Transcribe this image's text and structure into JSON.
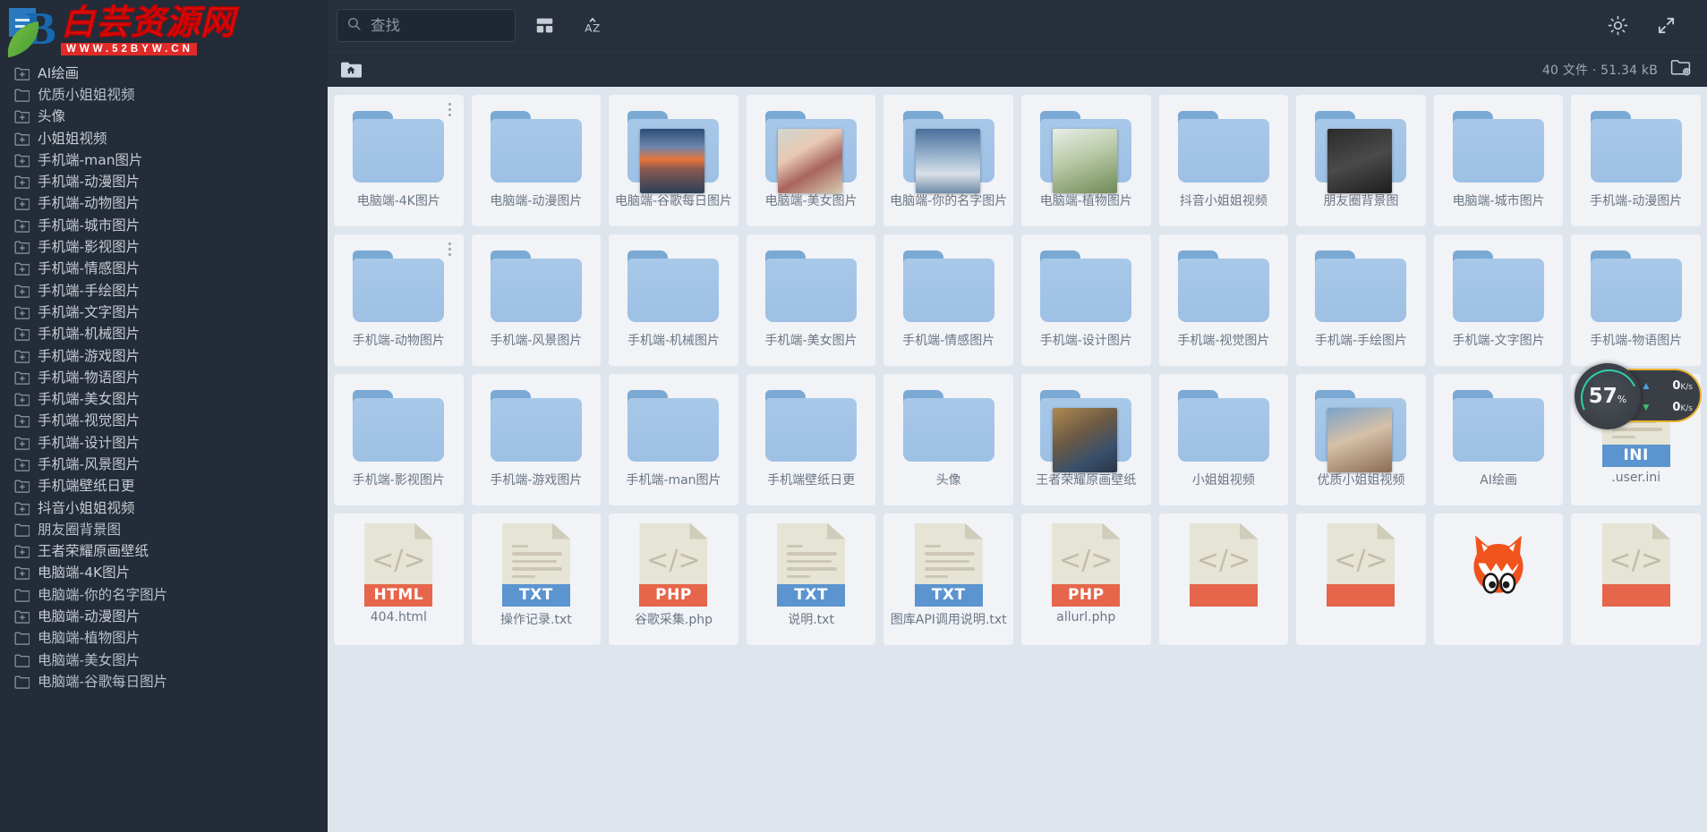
{
  "brand": {
    "title": "白芸资源网",
    "url": "WWW.52BYW.CN",
    "logo_icon": "leaf-b-logo-icon"
  },
  "sidebar": {
    "items": [
      {
        "label": "AI绘画",
        "icon": "folder-plus-icon",
        "expandable": true
      },
      {
        "label": "优质小姐姐视频",
        "icon": "folder-icon",
        "expandable": false
      },
      {
        "label": "头像",
        "icon": "folder-plus-icon",
        "expandable": true
      },
      {
        "label": "小姐姐视频",
        "icon": "folder-plus-icon",
        "expandable": true
      },
      {
        "label": "手机端-man图片",
        "icon": "folder-plus-icon",
        "expandable": true
      },
      {
        "label": "手机端-动漫图片",
        "icon": "folder-plus-icon",
        "expandable": true
      },
      {
        "label": "手机端-动物图片",
        "icon": "folder-plus-icon",
        "expandable": true
      },
      {
        "label": "手机端-城市图片",
        "icon": "folder-plus-icon",
        "expandable": true
      },
      {
        "label": "手机端-影视图片",
        "icon": "folder-plus-icon",
        "expandable": true
      },
      {
        "label": "手机端-情感图片",
        "icon": "folder-plus-icon",
        "expandable": true
      },
      {
        "label": "手机端-手绘图片",
        "icon": "folder-plus-icon",
        "expandable": true
      },
      {
        "label": "手机端-文字图片",
        "icon": "folder-plus-icon",
        "expandable": true
      },
      {
        "label": "手机端-机械图片",
        "icon": "folder-plus-icon",
        "expandable": true
      },
      {
        "label": "手机端-游戏图片",
        "icon": "folder-plus-icon",
        "expandable": true
      },
      {
        "label": "手机端-物语图片",
        "icon": "folder-plus-icon",
        "expandable": true
      },
      {
        "label": "手机端-美女图片",
        "icon": "folder-plus-icon",
        "expandable": true
      },
      {
        "label": "手机端-视觉图片",
        "icon": "folder-plus-icon",
        "expandable": true
      },
      {
        "label": "手机端-设计图片",
        "icon": "folder-plus-icon",
        "expandable": true
      },
      {
        "label": "手机端-风景图片",
        "icon": "folder-plus-icon",
        "expandable": true
      },
      {
        "label": "手机端壁纸日更",
        "icon": "folder-plus-icon",
        "expandable": true
      },
      {
        "label": "抖音小姐姐视频",
        "icon": "folder-plus-icon",
        "expandable": true
      },
      {
        "label": "朋友圈背景图",
        "icon": "folder-icon",
        "expandable": false
      },
      {
        "label": "王者荣耀原画壁纸",
        "icon": "folder-plus-icon",
        "expandable": true
      },
      {
        "label": "电脑端-4K图片",
        "icon": "folder-plus-icon",
        "expandable": true
      },
      {
        "label": "电脑端-你的名字图片",
        "icon": "folder-icon",
        "expandable": false
      },
      {
        "label": "电脑端-动漫图片",
        "icon": "folder-plus-icon",
        "expandable": true
      },
      {
        "label": "电脑端-植物图片",
        "icon": "folder-icon",
        "expandable": false
      },
      {
        "label": "电脑端-美女图片",
        "icon": "folder-icon",
        "expandable": false
      },
      {
        "label": "电脑端-谷歌每日图片",
        "icon": "folder-icon",
        "expandable": false
      }
    ]
  },
  "toolbar": {
    "search_placeholder": "查找",
    "search_value": "",
    "search_icon": "search-icon",
    "view_icon": "grid-view-icon",
    "sort_icon": "sort-az-icon",
    "theme_icon": "sun-brightness-icon",
    "fullscreen_icon": "fullscreen-expand-icon"
  },
  "pathbar": {
    "home_icon": "home-folder-icon",
    "count_text": "40 文件 · 51.34 kB",
    "settings_icon": "folder-settings-icon"
  },
  "files": [
    {
      "name": "电脑端-4K图片",
      "kind": "folder",
      "thumb": null,
      "badge": null,
      "menu": true
    },
    {
      "name": "电脑端-动漫图片",
      "kind": "folder",
      "thumb": null,
      "badge": null,
      "menu": false
    },
    {
      "name": "电脑端-谷歌每日图片",
      "kind": "folder",
      "thumb": "landscape-sunset",
      "badge": null,
      "menu": false
    },
    {
      "name": "电脑端-美女图片",
      "kind": "folder",
      "thumb": "portrait-woman",
      "badge": null,
      "menu": false
    },
    {
      "name": "电脑端-你的名字图片",
      "kind": "folder",
      "thumb": "anime-two-figures",
      "badge": null,
      "menu": false
    },
    {
      "name": "电脑端-植物图片",
      "kind": "folder",
      "thumb": "white-flower",
      "badge": null,
      "menu": false
    },
    {
      "name": "抖音小姐姐视频",
      "kind": "folder",
      "thumb": null,
      "badge": null,
      "menu": false
    },
    {
      "name": "朋友圈背景图",
      "kind": "folder",
      "thumb": "dark-text-card",
      "badge": null,
      "menu": false
    },
    {
      "name": "电脑端-城市图片",
      "kind": "folder",
      "thumb": null,
      "badge": null,
      "menu": false
    },
    {
      "name": "手机端-动漫图片",
      "kind": "folder",
      "thumb": null,
      "badge": null,
      "menu": false
    },
    {
      "name": "手机端-动物图片",
      "kind": "folder",
      "thumb": null,
      "badge": null,
      "menu": true
    },
    {
      "name": "手机端-风景图片",
      "kind": "folder",
      "thumb": null,
      "badge": null,
      "menu": false
    },
    {
      "name": "手机端-机械图片",
      "kind": "folder",
      "thumb": null,
      "badge": null,
      "menu": false
    },
    {
      "name": "手机端-美女图片",
      "kind": "folder",
      "thumb": null,
      "badge": null,
      "menu": false
    },
    {
      "name": "手机端-情感图片",
      "kind": "folder",
      "thumb": null,
      "badge": null,
      "menu": false
    },
    {
      "name": "手机端-设计图片",
      "kind": "folder",
      "thumb": null,
      "badge": null,
      "menu": false
    },
    {
      "name": "手机端-视觉图片",
      "kind": "folder",
      "thumb": null,
      "badge": null,
      "menu": false
    },
    {
      "name": "手机端-手绘图片",
      "kind": "folder",
      "thumb": null,
      "badge": null,
      "menu": false
    },
    {
      "name": "手机端-文字图片",
      "kind": "folder",
      "thumb": null,
      "badge": null,
      "menu": false
    },
    {
      "name": "手机端-物语图片",
      "kind": "folder",
      "thumb": null,
      "badge": null,
      "menu": false
    },
    {
      "name": "手机端-影视图片",
      "kind": "folder",
      "thumb": null,
      "badge": null,
      "menu": false
    },
    {
      "name": "手机端-游戏图片",
      "kind": "folder",
      "thumb": null,
      "badge": null,
      "menu": false
    },
    {
      "name": "手机端-man图片",
      "kind": "folder",
      "thumb": null,
      "badge": null,
      "menu": false
    },
    {
      "name": "手机端壁纸日更",
      "kind": "folder",
      "thumb": null,
      "badge": null,
      "menu": false
    },
    {
      "name": "头像",
      "kind": "folder",
      "thumb": null,
      "badge": null,
      "menu": false
    },
    {
      "name": "王者荣耀原画壁纸",
      "kind": "folder",
      "thumb": "game-warrior",
      "badge": null,
      "menu": false
    },
    {
      "name": "小姐姐视频",
      "kind": "folder",
      "thumb": null,
      "badge": null,
      "menu": false
    },
    {
      "name": "优质小姐姐视频",
      "kind": "folder",
      "thumb": "person-scene",
      "badge": null,
      "menu": false
    },
    {
      "name": "AI绘画",
      "kind": "folder",
      "thumb": null,
      "badge": null,
      "menu": false
    },
    {
      "name": ".user.ini",
      "kind": "doc-lines",
      "thumb": null,
      "badge": "INI",
      "badge_color": "#5b94cf",
      "menu": false
    },
    {
      "name": "404.html",
      "kind": "doc-code",
      "thumb": null,
      "badge": "HTML",
      "badge_color": "#e5664a",
      "menu": false
    },
    {
      "name": "操作记录.txt",
      "kind": "doc-lines",
      "thumb": null,
      "badge": "TXT",
      "badge_color": "#5b94cf",
      "menu": false
    },
    {
      "name": "谷歌采集.php",
      "kind": "doc-code",
      "thumb": null,
      "badge": "PHP",
      "badge_color": "#e5664a",
      "menu": false
    },
    {
      "name": "说明.txt",
      "kind": "doc-lines",
      "thumb": null,
      "badge": "TXT",
      "badge_color": "#5b94cf",
      "menu": false
    },
    {
      "name": "图库API调用说明.txt",
      "kind": "doc-lines",
      "thumb": null,
      "badge": "TXT",
      "badge_color": "#5b94cf",
      "menu": false
    },
    {
      "name": "allurl.php",
      "kind": "doc-code",
      "thumb": null,
      "badge": "PHP",
      "badge_color": "#e5664a",
      "menu": false
    },
    {
      "name": "",
      "kind": "doc-code",
      "thumb": null,
      "badge": "",
      "badge_color": "#e5664a",
      "menu": false
    },
    {
      "name": "",
      "kind": "doc-code",
      "thumb": null,
      "badge": "",
      "badge_color": "#e5664a",
      "menu": false
    },
    {
      "name": "",
      "kind": "fox",
      "thumb": null,
      "badge": null,
      "menu": false
    },
    {
      "name": "",
      "kind": "doc-code",
      "thumb": null,
      "badge": "",
      "badge_color": "#e5664a",
      "menu": false
    }
  ],
  "speed_widget": {
    "percent": "57",
    "percent_unit": "%",
    "upload": "0",
    "upload_unit": "K/s",
    "download": "0",
    "download_unit": "K/s",
    "up_icon": "arrow-up-icon",
    "down_icon": "arrow-down-icon",
    "accent_color": "#e8b12f"
  }
}
